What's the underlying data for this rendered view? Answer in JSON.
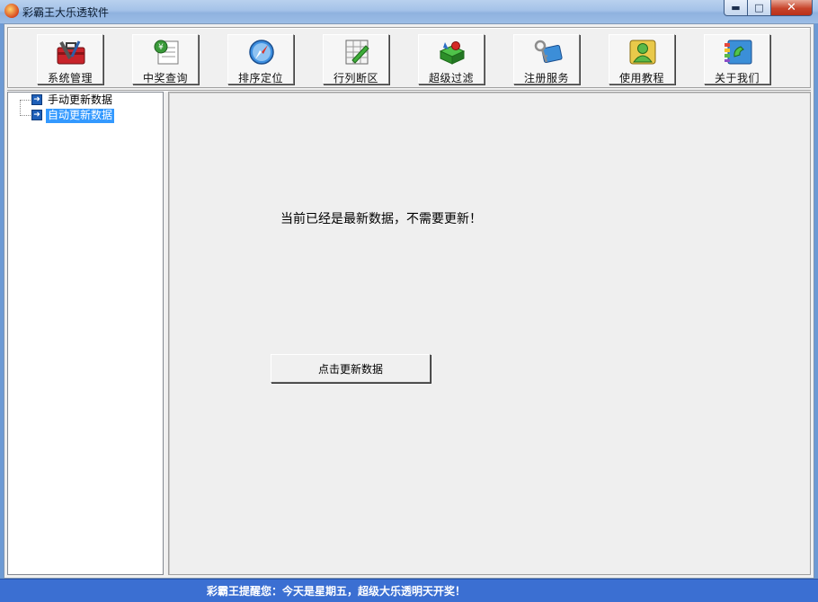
{
  "window": {
    "title": "彩霸王大乐透软件",
    "controls": {
      "minimize": "▬",
      "maximize": "□",
      "close": "✕"
    }
  },
  "toolbar": {
    "items": [
      {
        "label": "系统管理",
        "icon": "toolbox-icon"
      },
      {
        "label": "中奖查询",
        "icon": "lottery-ticket-icon"
      },
      {
        "label": "排序定位",
        "icon": "compass-icon"
      },
      {
        "label": "行列断区",
        "icon": "grid-pencil-icon"
      },
      {
        "label": "超级过滤",
        "icon": "filter-cube-icon"
      },
      {
        "label": "注册服务",
        "icon": "keys-icon"
      },
      {
        "label": "使用教程",
        "icon": "user-tutorial-icon"
      },
      {
        "label": "关于我们",
        "icon": "phone-book-icon"
      }
    ]
  },
  "tree": {
    "items": [
      {
        "label": "手动更新数据",
        "selected": false
      },
      {
        "label": "自动更新数据",
        "selected": true
      }
    ]
  },
  "main": {
    "message": "当前已经是最新数据，不需要更新！",
    "update_button": "点击更新数据"
  },
  "status": {
    "text": "彩霸王提醒您：今天是星期五，超级大乐透明天开奖！"
  },
  "colors": {
    "status_bar": "#3b6fd2",
    "selection": "#3399ff"
  }
}
